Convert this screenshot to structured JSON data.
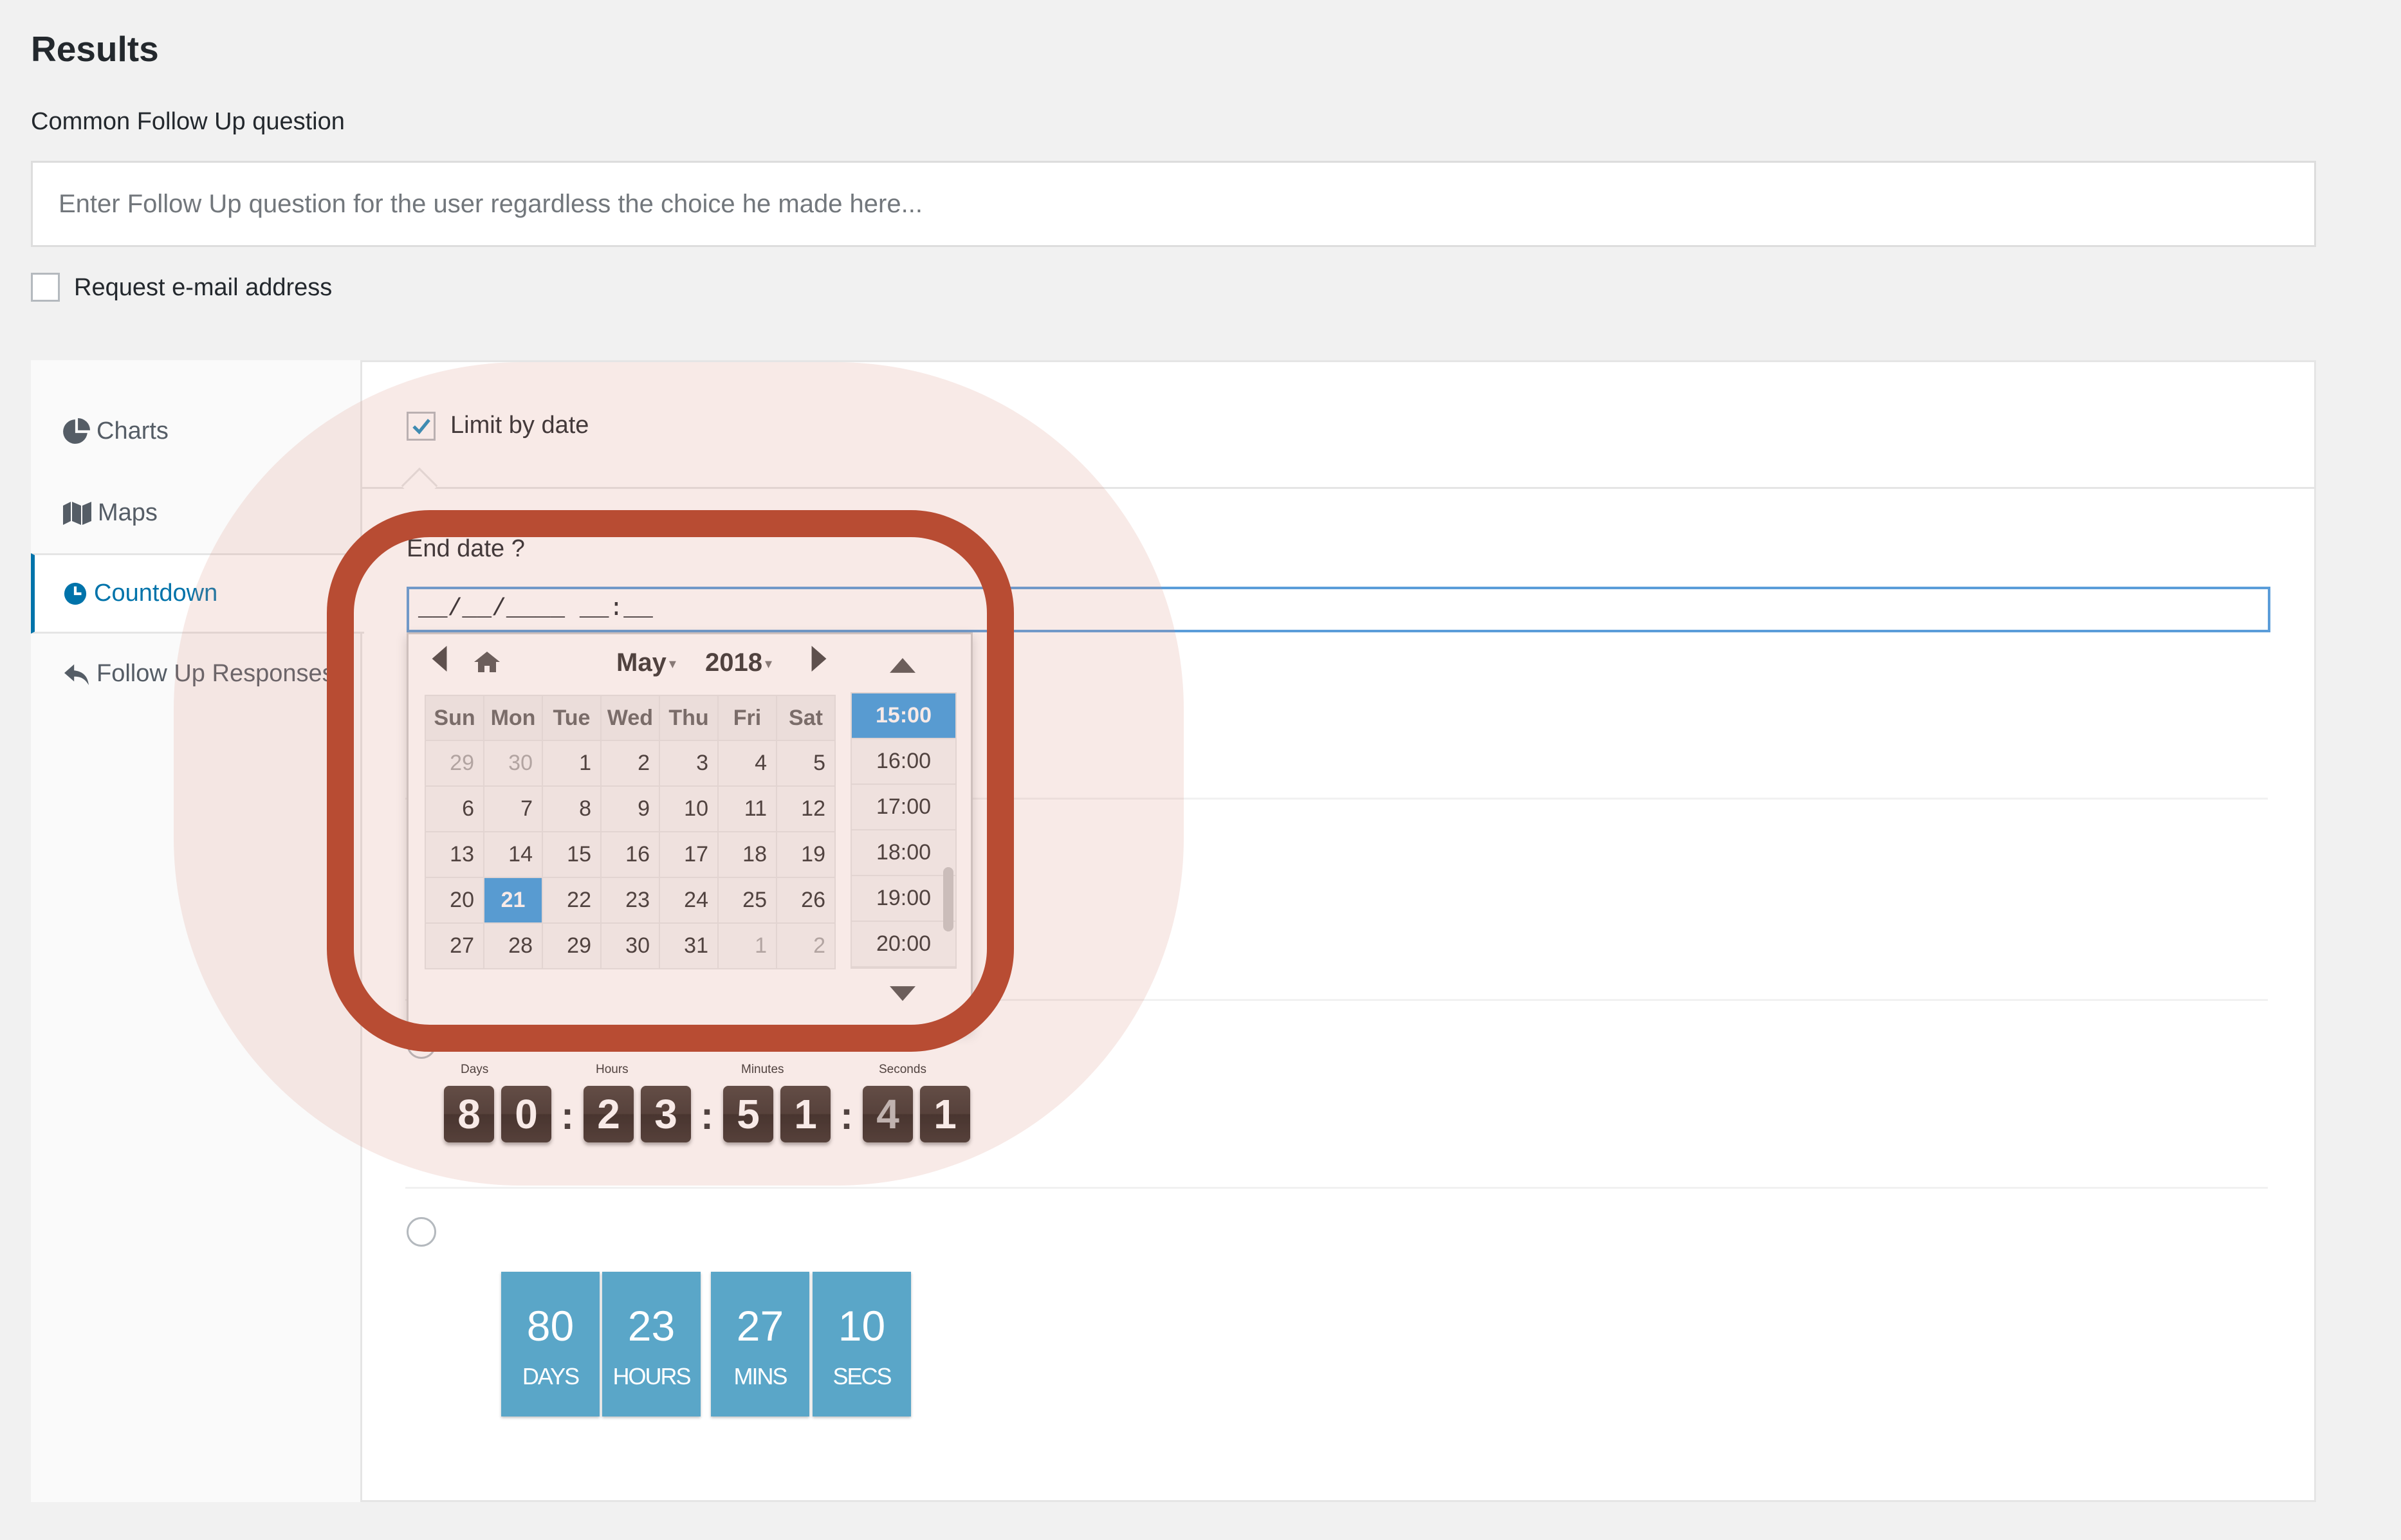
{
  "header": {
    "title": "Results",
    "follow_up_label": "Common Follow Up question",
    "follow_up_placeholder": "Enter Follow Up question for the user regardless the choice he made here...",
    "request_email_label": "Request e-mail address"
  },
  "sidebar": {
    "items": [
      {
        "label": "Charts",
        "icon": "pie-chart-icon"
      },
      {
        "label": "Maps",
        "icon": "map-icon"
      },
      {
        "label": "Countdown",
        "icon": "clock-icon",
        "active": true
      },
      {
        "label": "Follow Up Responses",
        "icon": "reply-icon"
      }
    ]
  },
  "countdown": {
    "limit_by_date_label": "Limit by date",
    "limit_by_date_checked": true,
    "end_date_label": "End date ?",
    "end_date_value": "__/__/____ __:__"
  },
  "datepicker": {
    "month": "May",
    "year": "2018",
    "weekdays": [
      "Sun",
      "Mon",
      "Tue",
      "Wed",
      "Thu",
      "Fri",
      "Sat"
    ],
    "weeks": [
      [
        "29",
        "30",
        "1",
        "2",
        "3",
        "4",
        "5"
      ],
      [
        "6",
        "7",
        "8",
        "9",
        "10",
        "11",
        "12"
      ],
      [
        "13",
        "14",
        "15",
        "16",
        "17",
        "18",
        "19"
      ],
      [
        "20",
        "21",
        "22",
        "23",
        "24",
        "25",
        "26"
      ],
      [
        "27",
        "28",
        "29",
        "30",
        "31",
        "1",
        "2"
      ]
    ],
    "selected_day": "21",
    "times": [
      "15:00",
      "16:00",
      "17:00",
      "18:00",
      "19:00",
      "20:00"
    ],
    "selected_time": "15:00"
  },
  "flip_countdown": {
    "captions": {
      "days": "Days",
      "hours": "Hours",
      "minutes": "Minutes",
      "seconds": "Seconds"
    },
    "digits": [
      "8",
      "0",
      "2",
      "3",
      "5",
      "1",
      "4",
      "1"
    ]
  },
  "box_countdown": [
    {
      "value": "80",
      "unit": "DAYS"
    },
    {
      "value": "23",
      "unit": "HOURS"
    },
    {
      "value": "27",
      "unit": "MINS"
    },
    {
      "value": "10",
      "unit": "SECS"
    }
  ],
  "colors": {
    "accent": "#0073aa",
    "selected": "#3c9fe5",
    "highlight_ring": "#b84c33",
    "box_bg": "#5aa6c8"
  }
}
